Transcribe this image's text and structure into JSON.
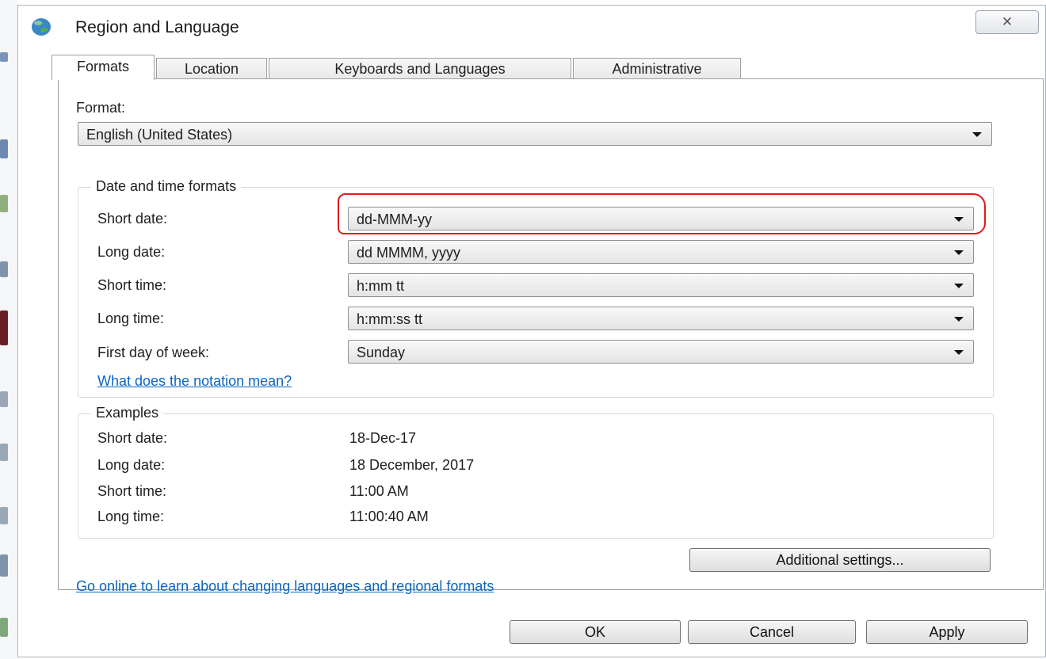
{
  "window": {
    "title": "Region and Language",
    "close_glyph": "✕"
  },
  "tabs": [
    {
      "label": "Formats",
      "active": true
    },
    {
      "label": "Location",
      "active": false
    },
    {
      "label": "Keyboards and Languages",
      "active": false
    },
    {
      "label": "Administrative",
      "active": false
    }
  ],
  "format": {
    "label": "Format:",
    "value": "English (United States)"
  },
  "date_time_formats": {
    "title": "Date and time formats",
    "rows": [
      {
        "label": "Short date:",
        "value": "dd-MMM-yy"
      },
      {
        "label": "Long date:",
        "value": "dd MMMM, yyyy"
      },
      {
        "label": "Short time:",
        "value": "h:mm tt"
      },
      {
        "label": "Long time:",
        "value": "h:mm:ss tt"
      },
      {
        "label": "First day of week:",
        "value": "Sunday"
      }
    ],
    "notation_link": "What does the notation mean?"
  },
  "examples": {
    "title": "Examples",
    "rows": [
      {
        "label": "Short date:",
        "value": "18-Dec-17"
      },
      {
        "label": "Long date:",
        "value": "18 December, 2017"
      },
      {
        "label": "Short time:",
        "value": "11:00 AM"
      },
      {
        "label": "Long time:",
        "value": "11:00:40 AM"
      }
    ]
  },
  "additional_settings_label": "Additional settings...",
  "online_link": "Go online to learn about changing languages and regional formats",
  "buttons": {
    "ok": "OK",
    "cancel": "Cancel",
    "apply": "Apply"
  },
  "colors": {
    "link": "#0a66c2",
    "annotation": "#e01b1b"
  },
  "icons": {
    "window_icon": "globe-icon",
    "dropdown": "chevron-down-icon"
  }
}
